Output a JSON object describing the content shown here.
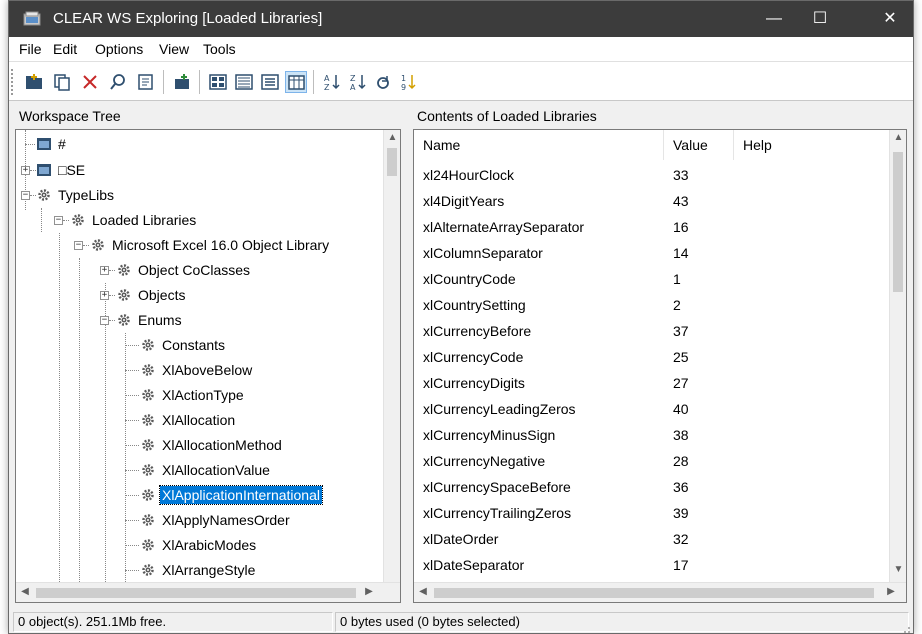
{
  "window": {
    "title": "CLEAR WS Exploring [Loaded Libraries]",
    "controls": {
      "minimize": "—",
      "maximize": "☐",
      "close": "✕"
    }
  },
  "menu": [
    "File",
    "Edit",
    "Options",
    "View",
    "Tools"
  ],
  "toolbar": {
    "buttons": [
      "new-folder-icon",
      "copy-icon",
      "delete-icon",
      "search-icon",
      "properties-icon",
      "new-item-icon",
      "large-icons-view-icon",
      "small-icons-view-icon",
      "list-view-icon",
      "details-view-icon",
      "sort-icon",
      "sort-descending-icon",
      "refresh-icon",
      "sort-numeric-icon"
    ]
  },
  "tree": {
    "header": "Workspace Tree",
    "nodes": [
      {
        "label": "#",
        "icon": "workspace-icon"
      },
      {
        "label": "□SE",
        "icon": "workspace-icon"
      },
      {
        "label": "TypeLibs",
        "icon": "gear-icon"
      },
      {
        "label": "Loaded Libraries",
        "icon": "gear-icon"
      },
      {
        "label": "Microsoft Excel 16.0 Object Library",
        "icon": "gear-icon"
      },
      {
        "label": "Object CoClasses",
        "icon": "gear-icon"
      },
      {
        "label": "Objects",
        "icon": "gear-icon"
      },
      {
        "label": "Enums",
        "icon": "gear-icon"
      },
      {
        "label": "Constants",
        "icon": "gear-icon"
      },
      {
        "label": "XlAboveBelow",
        "icon": "gear-icon"
      },
      {
        "label": "XlActionType",
        "icon": "gear-icon"
      },
      {
        "label": "XlAllocation",
        "icon": "gear-icon"
      },
      {
        "label": "XlAllocationMethod",
        "icon": "gear-icon"
      },
      {
        "label": "XlAllocationValue",
        "icon": "gear-icon"
      },
      {
        "label": "XlApplicationInternational",
        "icon": "gear-icon",
        "selected": true
      },
      {
        "label": "XlApplyNamesOrder",
        "icon": "gear-icon"
      },
      {
        "label": "XlArabicModes",
        "icon": "gear-icon"
      },
      {
        "label": "XlArrangeStyle",
        "icon": "gear-icon"
      }
    ]
  },
  "list": {
    "header": "Contents of Loaded Libraries",
    "columns": [
      "Name",
      "Value",
      "Help"
    ],
    "rows": [
      {
        "name": "xl24HourClock",
        "value": "33"
      },
      {
        "name": "xl4DigitYears",
        "value": "43"
      },
      {
        "name": "xlAlternateArraySeparator",
        "value": "16"
      },
      {
        "name": "xlColumnSeparator",
        "value": "14"
      },
      {
        "name": "xlCountryCode",
        "value": "1"
      },
      {
        "name": "xlCountrySetting",
        "value": "2"
      },
      {
        "name": "xlCurrencyBefore",
        "value": "37"
      },
      {
        "name": "xlCurrencyCode",
        "value": "25"
      },
      {
        "name": "xlCurrencyDigits",
        "value": "27"
      },
      {
        "name": "xlCurrencyLeadingZeros",
        "value": "40"
      },
      {
        "name": "xlCurrencyMinusSign",
        "value": "38"
      },
      {
        "name": "xlCurrencyNegative",
        "value": "28"
      },
      {
        "name": "xlCurrencySpaceBefore",
        "value": "36"
      },
      {
        "name": "xlCurrencyTrailingZeros",
        "value": "39"
      },
      {
        "name": "xlDateOrder",
        "value": "32"
      },
      {
        "name": "xlDateSeparator",
        "value": "17"
      }
    ]
  },
  "status": {
    "left": "0 object(s). 251.1Mb free.",
    "right": "0 bytes used (0 bytes selected)"
  },
  "colors": {
    "titlebar": "#3c3c3c",
    "selection": "#0078d7",
    "gear": "#5a5a5a"
  }
}
